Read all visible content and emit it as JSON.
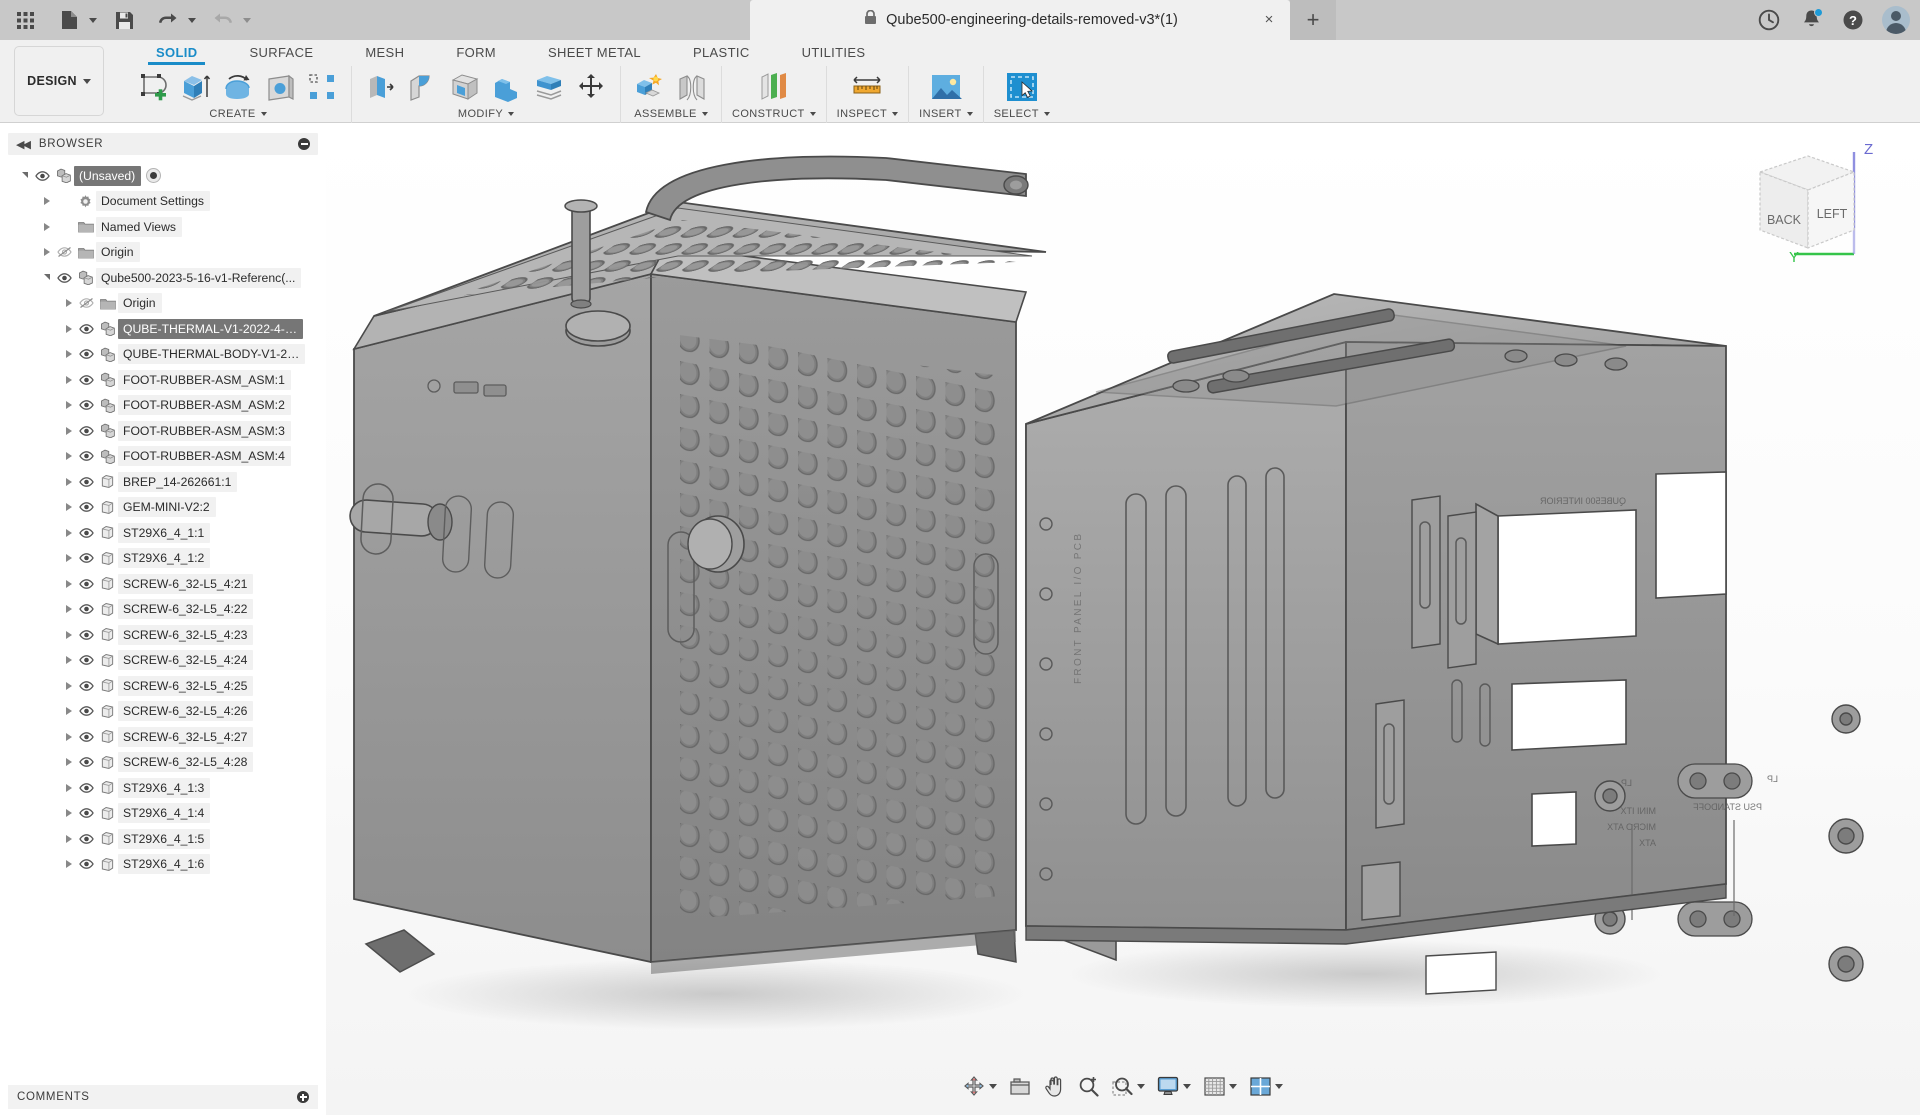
{
  "titlebar": {
    "doc_title": "Qube500-engineering-details-removed-v3*(1)",
    "lock_icon": "lock-icon",
    "close_label": "×",
    "new_tab_label": "+",
    "grid_icon": "app-grid-icon",
    "file_icon": "new-file-icon",
    "save_icon": "save-icon",
    "undo_icon": "undo-icon",
    "redo_icon": "redo-icon",
    "recent_icon": "clock-icon",
    "notifications_icon": "bell-icon",
    "help_icon": "help-icon",
    "account_icon": "avatar"
  },
  "ribbon": {
    "workspace_label": "DESIGN",
    "tabs": [
      {
        "label": "SOLID",
        "active": true
      },
      {
        "label": "SURFACE",
        "active": false
      },
      {
        "label": "MESH",
        "active": false
      },
      {
        "label": "FORM",
        "active": false
      },
      {
        "label": "SHEET METAL",
        "active": false
      },
      {
        "label": "PLASTIC",
        "active": false
      },
      {
        "label": "UTILITIES",
        "active": false
      }
    ],
    "panels": [
      {
        "label": "CREATE",
        "dropdown": true,
        "icons": [
          "create-sketch-icon",
          "extrude-icon",
          "revolve-icon",
          "sweep-icon",
          "pattern-icon"
        ]
      },
      {
        "label": "MODIFY",
        "dropdown": true,
        "icons": [
          "press-pull-icon",
          "fillet-icon",
          "shell-icon",
          "combine-icon",
          "offset-face-icon",
          "move-copy-icon"
        ]
      },
      {
        "label": "ASSEMBLE",
        "dropdown": true,
        "icons": [
          "new-component-icon",
          "joint-icon"
        ]
      },
      {
        "label": "CONSTRUCT",
        "dropdown": true,
        "icons": [
          "offset-plane-icon"
        ]
      },
      {
        "label": "INSPECT",
        "dropdown": true,
        "icons": [
          "measure-icon"
        ]
      },
      {
        "label": "INSERT",
        "dropdown": true,
        "icons": [
          "insert-canvas-icon"
        ]
      },
      {
        "label": "SELECT",
        "dropdown": true,
        "icons": [
          "select-window-icon"
        ]
      }
    ]
  },
  "browser": {
    "title": "BROWSER",
    "collapse_icon": "collapse-left-icon",
    "minimize_icon": "circle-minus-icon",
    "tree": [
      {
        "label": "(Unsaved)",
        "indent": 0,
        "twist": "down",
        "eye": "visible",
        "icon": "component-icon",
        "selected": true,
        "radio": true
      },
      {
        "label": "Document Settings",
        "indent": 1,
        "twist": "right",
        "eye": "none",
        "icon": "gear-icon",
        "selected": false,
        "radio": false
      },
      {
        "label": "Named Views",
        "indent": 1,
        "twist": "right",
        "eye": "none",
        "icon": "folder-icon",
        "selected": false,
        "radio": false
      },
      {
        "label": "Origin",
        "indent": 1,
        "twist": "right",
        "eye": "hidden",
        "icon": "folder-icon",
        "selected": false,
        "radio": false
      },
      {
        "label": "Qube500-2023-5-16-v1-Referenc(...",
        "indent": 1,
        "twist": "down",
        "eye": "visible",
        "icon": "component-icon",
        "selected": false,
        "radio": false
      },
      {
        "label": "Origin",
        "indent": 2,
        "twist": "right",
        "eye": "hidden",
        "icon": "folder-icon",
        "selected": false,
        "radio": false
      },
      {
        "label": "QUBE-THERMAL-V1-2022-4-…",
        "indent": 2,
        "twist": "right",
        "eye": "visible",
        "icon": "component-icon",
        "selected": true,
        "radio": false
      },
      {
        "label": "QUBE-THERMAL-BODY-V1-2…",
        "indent": 2,
        "twist": "right",
        "eye": "visible",
        "icon": "component-icon",
        "selected": false,
        "radio": false
      },
      {
        "label": "FOOT-RUBBER-ASM_ASM:1",
        "indent": 2,
        "twist": "right",
        "eye": "visible",
        "icon": "component-icon",
        "selected": false,
        "radio": false
      },
      {
        "label": "FOOT-RUBBER-ASM_ASM:2",
        "indent": 2,
        "twist": "right",
        "eye": "visible",
        "icon": "component-icon",
        "selected": false,
        "radio": false
      },
      {
        "label": "FOOT-RUBBER-ASM_ASM:3",
        "indent": 2,
        "twist": "right",
        "eye": "visible",
        "icon": "component-icon",
        "selected": false,
        "radio": false
      },
      {
        "label": "FOOT-RUBBER-ASM_ASM:4",
        "indent": 2,
        "twist": "right",
        "eye": "visible",
        "icon": "component-icon",
        "selected": false,
        "radio": false
      },
      {
        "label": "BREP_14-262661:1",
        "indent": 2,
        "twist": "right",
        "eye": "visible",
        "icon": "body-icon",
        "selected": false,
        "radio": false
      },
      {
        "label": "GEM-MINI-V2:2",
        "indent": 2,
        "twist": "right",
        "eye": "visible",
        "icon": "body-icon",
        "selected": false,
        "radio": false
      },
      {
        "label": "ST29X6_4_1:1",
        "indent": 2,
        "twist": "right",
        "eye": "visible",
        "icon": "body-icon",
        "selected": false,
        "radio": false
      },
      {
        "label": "ST29X6_4_1:2",
        "indent": 2,
        "twist": "right",
        "eye": "visible",
        "icon": "body-icon",
        "selected": false,
        "radio": false
      },
      {
        "label": "SCREW-6_32-L5_4:21",
        "indent": 2,
        "twist": "right",
        "eye": "visible",
        "icon": "body-icon",
        "selected": false,
        "radio": false
      },
      {
        "label": "SCREW-6_32-L5_4:22",
        "indent": 2,
        "twist": "right",
        "eye": "visible",
        "icon": "body-icon",
        "selected": false,
        "radio": false
      },
      {
        "label": "SCREW-6_32-L5_4:23",
        "indent": 2,
        "twist": "right",
        "eye": "visible",
        "icon": "body-icon",
        "selected": false,
        "radio": false
      },
      {
        "label": "SCREW-6_32-L5_4:24",
        "indent": 2,
        "twist": "right",
        "eye": "visible",
        "icon": "body-icon",
        "selected": false,
        "radio": false
      },
      {
        "label": "SCREW-6_32-L5_4:25",
        "indent": 2,
        "twist": "right",
        "eye": "visible",
        "icon": "body-icon",
        "selected": false,
        "radio": false
      },
      {
        "label": "SCREW-6_32-L5_4:26",
        "indent": 2,
        "twist": "right",
        "eye": "visible",
        "icon": "body-icon",
        "selected": false,
        "radio": false
      },
      {
        "label": "SCREW-6_32-L5_4:27",
        "indent": 2,
        "twist": "right",
        "eye": "visible",
        "icon": "body-icon",
        "selected": false,
        "radio": false
      },
      {
        "label": "SCREW-6_32-L5_4:28",
        "indent": 2,
        "twist": "right",
        "eye": "visible",
        "icon": "body-icon",
        "selected": false,
        "radio": false
      },
      {
        "label": "ST29X6_4_1:3",
        "indent": 2,
        "twist": "right",
        "eye": "visible",
        "icon": "body-icon",
        "selected": false,
        "radio": false
      },
      {
        "label": "ST29X6_4_1:4",
        "indent": 2,
        "twist": "right",
        "eye": "visible",
        "icon": "body-icon",
        "selected": false,
        "radio": false
      },
      {
        "label": "ST29X6_4_1:5",
        "indent": 2,
        "twist": "right",
        "eye": "visible",
        "icon": "body-icon",
        "selected": false,
        "radio": false
      },
      {
        "label": "ST29X6_4_1:6",
        "indent": 2,
        "twist": "right",
        "eye": "visible",
        "icon": "body-icon",
        "selected": false,
        "radio": false
      }
    ]
  },
  "comments": {
    "title": "COMMENTS",
    "add_icon": "circle-plus-icon"
  },
  "viewcube": {
    "face_back": "BACK",
    "face_left": "LEFT",
    "axis_z": "Z",
    "axis_y": "Y",
    "color_z": "#8f8fe0",
    "color_y": "#35c44a"
  },
  "navbar": {
    "items": [
      {
        "name": "orbit-icon",
        "dropdown": true
      },
      {
        "name": "look-at-icon",
        "dropdown": false
      },
      {
        "name": "pan-icon",
        "dropdown": false
      },
      {
        "name": "zoom-icon",
        "dropdown": false
      },
      {
        "name": "zoom-window-icon",
        "dropdown": true
      },
      {
        "name": "display-settings-icon",
        "dropdown": true
      },
      {
        "name": "grid-snaps-icon",
        "dropdown": true
      },
      {
        "name": "viewports-icon",
        "dropdown": true
      }
    ]
  },
  "colors": {
    "accent": "#1a8cc8",
    "titlebar_bg": "#c8c8c8",
    "ribbon_bg": "#f0f0f0",
    "selection_bg": "#767676",
    "model_grey": "#8e8e8e",
    "notification_badge": "#1e9ad6"
  }
}
